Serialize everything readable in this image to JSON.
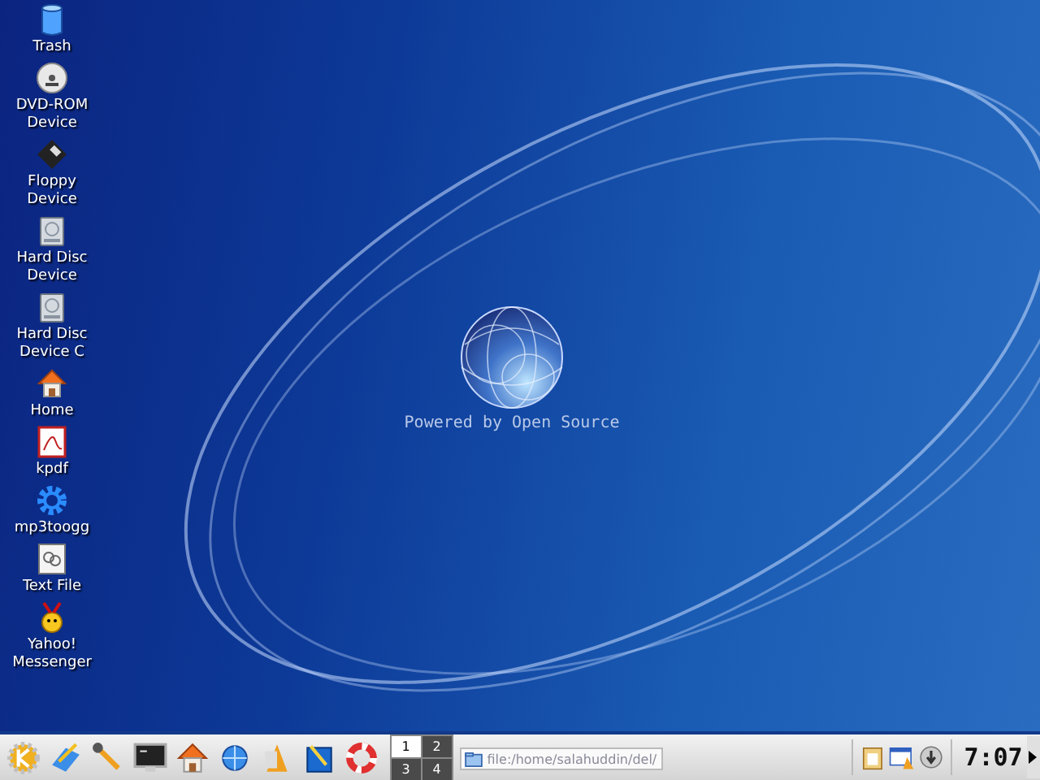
{
  "desktop_icons": [
    {
      "label": "Trash",
      "kind": "trash"
    },
    {
      "label": "DVD-ROM Device",
      "kind": "dvd"
    },
    {
      "label": "Floppy Device",
      "kind": "floppy"
    },
    {
      "label": "Hard Disc Device",
      "kind": "disk"
    },
    {
      "label": "Hard Disc Device C",
      "kind": "disk"
    },
    {
      "label": "Home",
      "kind": "home"
    },
    {
      "label": "kpdf",
      "kind": "pdf"
    },
    {
      "label": "mp3toogg",
      "kind": "gear"
    },
    {
      "label": "Text File",
      "kind": "text"
    },
    {
      "label": "Yahoo! Messenger",
      "kind": "yahoo"
    }
  ],
  "wallpaper": {
    "caption": "Powered by Open Source"
  },
  "taskbar": {
    "launchers": [
      {
        "kind": "kmenu"
      },
      {
        "kind": "pen"
      },
      {
        "kind": "wrench"
      },
      {
        "kind": "terminal"
      },
      {
        "kind": "home"
      },
      {
        "kind": "globe"
      },
      {
        "kind": "office"
      },
      {
        "kind": "drawing"
      },
      {
        "kind": "lifebuoy"
      }
    ],
    "pager": [
      {
        "label": "1",
        "selected": true
      },
      {
        "label": "2",
        "selected": false
      },
      {
        "label": "3",
        "selected": false
      },
      {
        "label": "4",
        "selected": false
      }
    ],
    "tasks": [
      {
        "label": "file:/home/salahuddin/del/"
      }
    ],
    "tray": [
      {
        "kind": "clipboard"
      },
      {
        "kind": "calendar"
      },
      {
        "kind": "download"
      }
    ],
    "clock": "7:07"
  }
}
